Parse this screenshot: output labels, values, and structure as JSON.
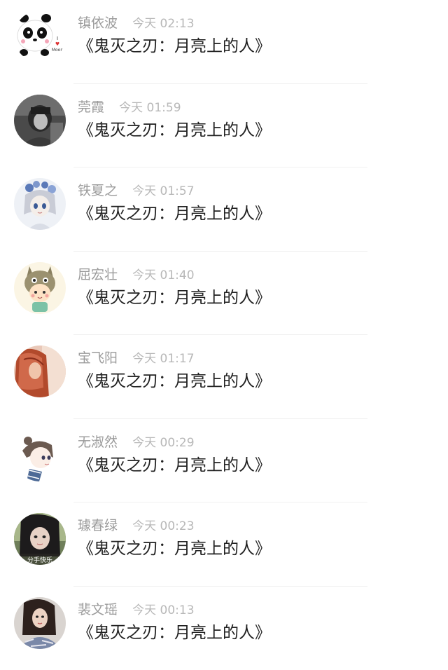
{
  "comments": [
    {
      "name": "镇依波",
      "time": "今天 02:13",
      "text": "《鬼灭之刃：月亮上的人》",
      "avatar_icon": "panda-avatar-icon",
      "avatar_text": "I ♥ Moon"
    },
    {
      "name": "莞霞",
      "time": "今天 01:59",
      "text": "《鬼灭之刃：月亮上的人》",
      "avatar_icon": "monochrome-girl-avatar-icon"
    },
    {
      "name": "铁夏之",
      "time": "今天 01:57",
      "text": "《鬼灭之刃：月亮上的人》",
      "avatar_icon": "anime-girl-flower-crown-avatar-icon"
    },
    {
      "name": "屈宏壮",
      "time": "今天 01:40",
      "text": "《鬼灭之刃：月亮上的人》",
      "avatar_icon": "totoro-hat-cartoon-avatar-icon"
    },
    {
      "name": "宝飞阳",
      "time": "今天 01:17",
      "text": "《鬼灭之刃：月亮上的人》",
      "avatar_icon": "red-hair-girl-avatar-icon"
    },
    {
      "name": "无淑然",
      "time": "今天 00:29",
      "text": "《鬼灭之刃：月亮上的人》",
      "avatar_icon": "anime-girl-sketch-avatar-icon"
    },
    {
      "name": "璩春绿",
      "time": "今天 00:23",
      "text": "《鬼灭之刃：月亮上的人》",
      "avatar_icon": "girl-photo-caption-avatar-icon",
      "avatar_caption": "分手快乐"
    },
    {
      "name": "裴文瑶",
      "time": "今天 00:13",
      "text": "《鬼灭之刃：月亮上的人》",
      "avatar_icon": "woman-photo-avatar-icon"
    }
  ],
  "colors": {
    "name": "#9b9b9b",
    "time": "#b8b8b8",
    "message": "#222222",
    "divider": "#f0f0f0"
  }
}
